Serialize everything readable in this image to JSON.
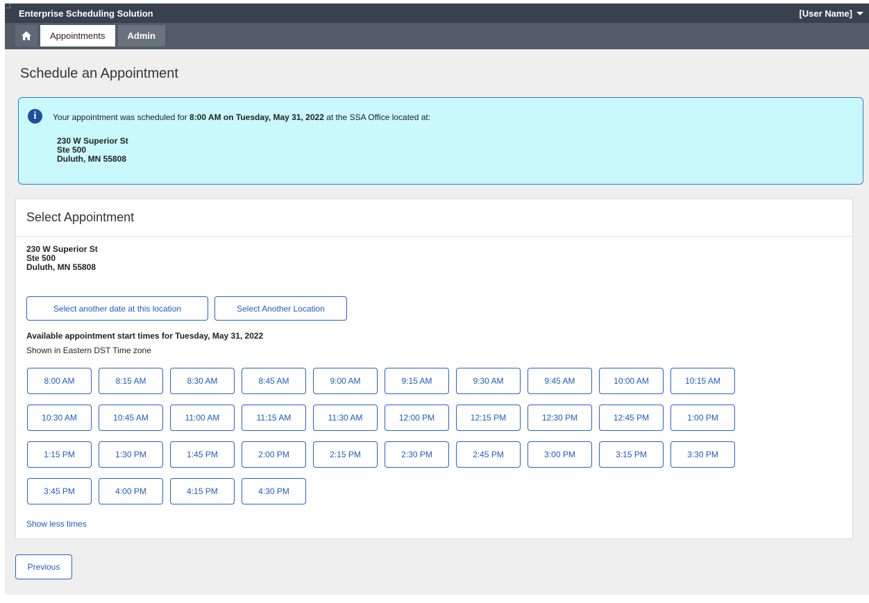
{
  "app": {
    "title": "Enterprise Scheduling Solution",
    "user_menu_label": "[User Name]"
  },
  "nav": {
    "home_icon": "home-icon",
    "tabs": [
      {
        "label": "Appointments",
        "active": true
      },
      {
        "label": "Admin",
        "active": false
      }
    ]
  },
  "page": {
    "title": "Schedule an Appointment"
  },
  "alert": {
    "icon": "info-icon",
    "msg_prefix": "Your appointment was scheduled for ",
    "msg_bold": "8:00 AM on Tuesday, May 31, 2022",
    "msg_suffix": " at the SSA Office located at:",
    "address_line1": "230 W Superior St",
    "address_line2": "Ste 500",
    "address_line3": "Duluth, MN  55808"
  },
  "select_card": {
    "header": "Select Appointment",
    "address_line1": "230 W Superior St",
    "address_line2": "Ste 500",
    "address_line3": "Duluth, MN  55808",
    "select_another_date_label": "Select another date at this location",
    "select_another_location_label": "Select  Another Location",
    "available_title": "Available appointment start times for Tuesday, May 31, 2022",
    "timezone_note": "Shown in Eastern DST Time zone",
    "times": [
      "8:00 AM",
      "8:15 AM",
      "8:30 AM",
      "8:45 AM",
      "9:00 AM",
      "9:15 AM",
      "9:30 AM",
      "9:45 AM",
      "10:00 AM",
      "10:15 AM",
      "10:30 AM",
      "10:45 AM",
      "11:00 AM",
      "11:15 AM",
      "11:30 AM",
      "12:00 PM",
      "12:15 PM",
      "12:30 PM",
      "12:45 PM",
      "1:00 PM",
      "1:15 PM",
      "1:30 PM",
      "1:45 PM",
      "2:00 PM",
      "2:15 PM",
      "2:30 PM",
      "2:45 PM",
      "3:00 PM",
      "3:15 PM",
      "3:30 PM",
      "3:45 PM",
      "4:00 PM",
      "4:15 PM",
      "4:30 PM"
    ],
    "show_less_label": "Show less times"
  },
  "footer": {
    "previous_label": "Previous"
  },
  "colors": {
    "topbar": "#38424f",
    "navbar": "#525b67",
    "alert_bg": "#c9f9fb",
    "accent": "#2461c7"
  }
}
